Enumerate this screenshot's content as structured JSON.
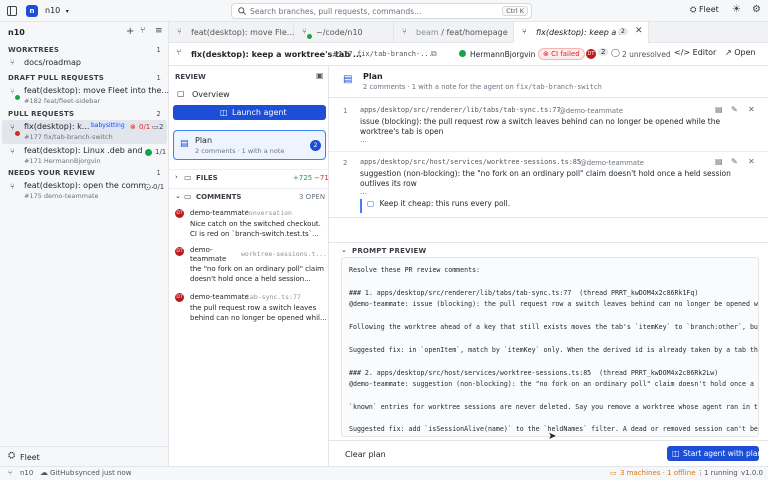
{
  "topbar": {
    "workspace": "n10",
    "search_placeholder": "Search branches, pull requests, commands...",
    "search_kbd": "Ctrl K",
    "fleet_label": "Fleet"
  },
  "sidebar": {
    "title": "n10",
    "sections": {
      "worktrees": {
        "label": "WORKTREES",
        "count": "1"
      },
      "draft": {
        "label": "DRAFT PULL REQUESTS",
        "count": "1"
      },
      "prs": {
        "label": "PULL REQUESTS",
        "count": "2"
      },
      "needs": {
        "label": "NEEDS YOUR REVIEW",
        "count": "1"
      }
    },
    "worktree_item": "docs/roadmap",
    "draft_item": {
      "title": "feat(desktop): move Fleet into the...",
      "sub": "#182  feat/fleet-sidebar"
    },
    "pr_items": [
      {
        "title": "fix(desktop): k...",
        "badge": "babysitting",
        "sub": "#177  fix/tab-branch-switch",
        "checks": "0/1",
        "comments": "2"
      },
      {
        "title": "feat(desktop): Linux .deb and ...",
        "sub": "#171  HermannBjorgvin",
        "checks": "1/1"
      }
    ],
    "review_item": {
      "title": "feat(desktop): open the comm...",
      "sub": "#175  demo-teammate",
      "checks": "0/1"
    },
    "fleet_footer": "Fleet"
  },
  "tabs": [
    {
      "label": "feat(desktop): move Fle..."
    },
    {
      "label": "~/code/n10"
    },
    {
      "label_a": "beam",
      "label_b": " / feat/homepage"
    },
    {
      "label": "fix(desktop): keep a ...",
      "badge": "2"
    }
  ],
  "pr_header": {
    "title": "fix(desktop): keep a worktree's tab ...",
    "number": "#177",
    "branch": "fix/tab-branch-...",
    "author": "HermannBjorgvin",
    "ci": "CI failed",
    "reviewer_count": "2",
    "unresolved": "2 unresolved",
    "editor": "Editor",
    "open": "Open"
  },
  "review": {
    "header": "REVIEW",
    "overview": "Overview",
    "launch": "Launch agent",
    "plan_title": "Plan",
    "plan_sub": "2 comments · 1 with a note",
    "plan_badge": "2",
    "files_label": "FILES",
    "files_add": "+725",
    "files_del": "−71",
    "comments_label": "COMMENTS",
    "comments_open": "3 OPEN",
    "comments": [
      {
        "author": "demo-teammate",
        "loc": "Conversation",
        "l1": "Nice catch on the switched checkout.",
        "l2": "CI is red on `branch-switch.test.ts`..."
      },
      {
        "author": "demo-",
        "author2": "teammate",
        "loc": "worktree-sessions.t...",
        "l1": "the \"no fork on an ordinary poll\" claim",
        "l2": "doesn't hold once a held session..."
      },
      {
        "author": "demo-teammate",
        "loc": "tab-sync.ts:77",
        "l1": "the pull request row a switch leaves",
        "l2": "behind can no longer be opened whil..."
      }
    ]
  },
  "plan": {
    "title": "Plan",
    "sub_a": "2 comments · 1 with a note for the agent on ",
    "sub_branch": "fix/tab-branch-switch",
    "entries": [
      {
        "num": "1",
        "path": "apps/desktop/src/renderer/lib/tabs/tab-sync.ts:77",
        "author": "@demo-teammate",
        "l1": "issue (blocking): the pull request row a switch leaves behind can no longer be opened while the",
        "l2": "worktree's tab is open",
        "more": "..."
      },
      {
        "num": "2",
        "path": "apps/desktop/src/host/services/worktree-sessions.ts:85",
        "author": "@demo-teammate",
        "l1": "suggestion (non-blocking): the \"no fork on an ordinary poll\" claim doesn't hold once a held session",
        "l2": "outlives its row",
        "more": "...",
        "note": "Keep it cheap: this runs every poll."
      }
    ],
    "preview_label": "PROMPT PREVIEW",
    "preview_lines": [
      "Resolve these PR review comments:",
      "",
      "### 1. apps/desktop/src/renderer/lib/tabs/tab-sync.ts:77  (thread PRRT_kwDOM4x2c86Rk1Fq)",
      "@demo-teammate: issue (blocking): the pull request row a switch leaves behind can no longer be opened w",
      "",
      "Following the worktree ahead of a key that still exists moves the tab's `itemKey` to `branch:other`, bu",
      "",
      "Suggested fix: in `openItem`, match by `itemKey` only. When the derived id is already taken by a tab th",
      "",
      "### 2. apps/desktop/src/host/services/worktree-sessions.ts:85  (thread PRRT_kwDOM4x2c86Rk2Lw)",
      "@demo-teammate: suggestion (non-blocking): the \"no fork on an ordinary poll\" claim doesn't hold once a",
      "",
      "`known` entries for worktree sessions are never deleted. Say you remove a worktree whose agent ran in t",
      "",
      "Suggested fix: add `isSessionAlive(name)` to the `heldNames` filter. A dead or removed session can't be"
    ],
    "clear": "Clear plan",
    "start": "Start agent with plan"
  },
  "status": {
    "branch": "n10",
    "github": "GitHub",
    "synced": "synced just now",
    "machines": "3 machines · 1 offline",
    "running": "1 running",
    "version": "v1.0.0"
  },
  "colors": {
    "accent": "#1d4ed8",
    "danger": "#dc2626",
    "success": "#16a34a",
    "warn": "#d97706"
  }
}
